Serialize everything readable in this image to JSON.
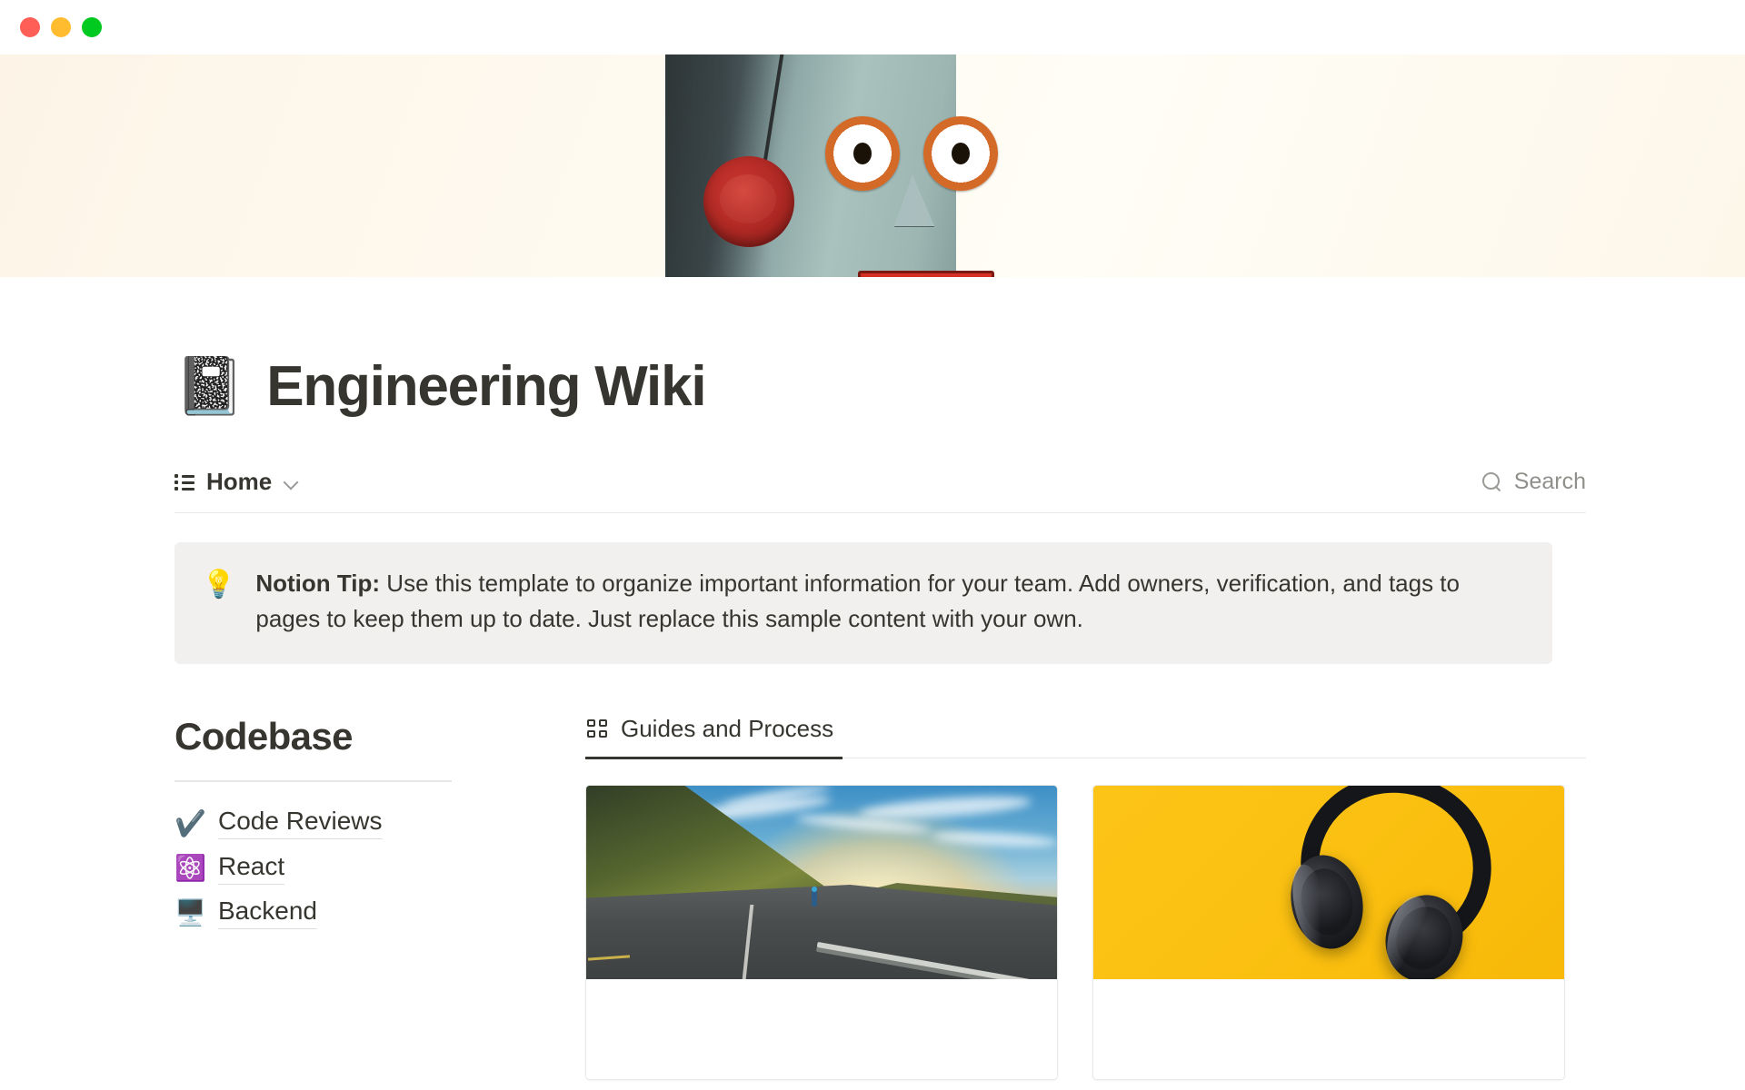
{
  "window": {
    "controls": [
      {
        "name": "close",
        "color": "#ff5f57"
      },
      {
        "name": "minimize",
        "color": "#febc2e"
      },
      {
        "name": "maximize",
        "color": "#00c91f"
      }
    ]
  },
  "cover": {
    "alt": "Vintage tin toy robot face on cream background",
    "background_color": "#fdf8ec"
  },
  "header": {
    "emoji": "📓",
    "emoji_name": "notebook-emoji",
    "title": "Engineering Wiki"
  },
  "nav": {
    "icon_name": "list-view-icon",
    "label": "Home",
    "chevron_name": "chevron-down-icon",
    "search": {
      "icon_name": "search-icon",
      "label": "Search"
    }
  },
  "callout": {
    "emoji": "💡",
    "emoji_name": "lightbulb-emoji",
    "bold_prefix": "Notion Tip:",
    "text": " Use this template to organize important information for your team. Add owners, verification, and tags to pages to keep them up to date. Just replace this sample content with your own.",
    "background_color": "#f1f0ee"
  },
  "codebase": {
    "heading": "Codebase",
    "links": [
      {
        "emoji": "✔️",
        "emoji_name": "check-mark-emoji",
        "label": "Code Reviews"
      },
      {
        "emoji": "⚛️",
        "emoji_name": "react-atom-emoji",
        "label": "React"
      },
      {
        "emoji": "🖥️",
        "emoji_name": "desktop-computer-emoji",
        "label": "Backend"
      }
    ]
  },
  "guides": {
    "tabs": [
      {
        "icon_name": "gallery-grid-icon",
        "label": "Guides and Process",
        "active": true
      }
    ],
    "cards": [
      {
        "name": "card-road-sunset",
        "alt": "Runner on a winding road at sunset"
      },
      {
        "name": "card-headphones",
        "alt": "Black headphones on a yellow background"
      }
    ]
  }
}
